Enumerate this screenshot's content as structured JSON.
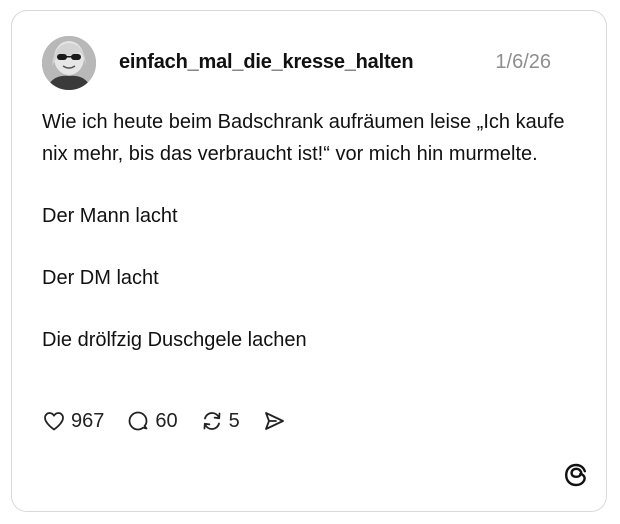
{
  "post": {
    "username": "einfach_mal_die_kresse_halten",
    "date": "1/6/26",
    "paragraphs": [
      "Wie ich heute beim Badschrank aufräumen leise „Ich kaufe nix mehr, bis das verbraucht ist!“ vor mich hin murmelte.",
      "Der Mann lacht",
      "Der DM lacht",
      "Die drölfzig Duschgele lachen"
    ]
  },
  "actions": {
    "likes": "967",
    "replies": "60",
    "reposts": "5"
  },
  "icons": {
    "like": "heart-icon",
    "reply": "comment-icon",
    "repost": "repost-icon",
    "share": "send-icon",
    "brand": "threads-logo-icon"
  },
  "colors": {
    "text": "#111111",
    "muted": "#8e8e8e",
    "border": "#d9d9d9"
  }
}
